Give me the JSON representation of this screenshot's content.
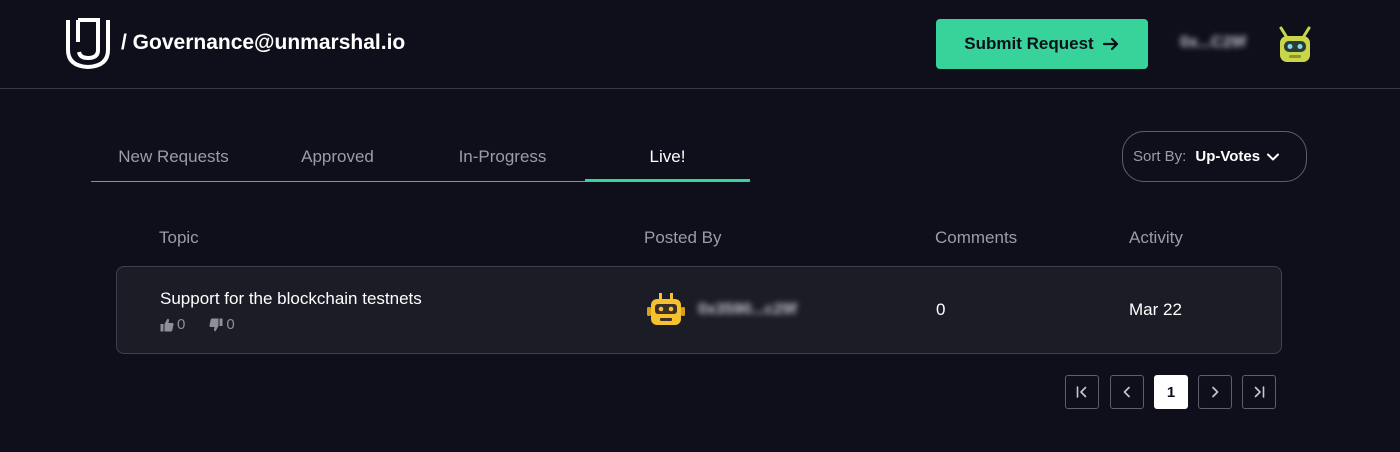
{
  "header": {
    "title": "/ Governance@unmarshal.io",
    "submit_label": "Submit Request",
    "wallet_address": "0x...C29f"
  },
  "tabs": [
    {
      "label": "New Requests",
      "active": false
    },
    {
      "label": "Approved",
      "active": false
    },
    {
      "label": "In-Progress",
      "active": false
    },
    {
      "label": "Live!",
      "active": true
    }
  ],
  "sort": {
    "label": "Sort By:",
    "value": "Up-Votes"
  },
  "table": {
    "columns": [
      "Topic",
      "Posted By",
      "Comments",
      "Activity"
    ],
    "rows": [
      {
        "topic": "Support for the blockchain testnets",
        "upvotes": "0",
        "downvotes": "0",
        "posted_by": "0x3590...c29f",
        "comments": "0",
        "activity": "Mar 22"
      }
    ]
  },
  "pagination": {
    "current_page": "1"
  },
  "colors": {
    "background": "#0e0f1a",
    "accent": "#37d39b",
    "row_background": "#1b1c26",
    "avatar_yellow": "#f5c12e"
  }
}
